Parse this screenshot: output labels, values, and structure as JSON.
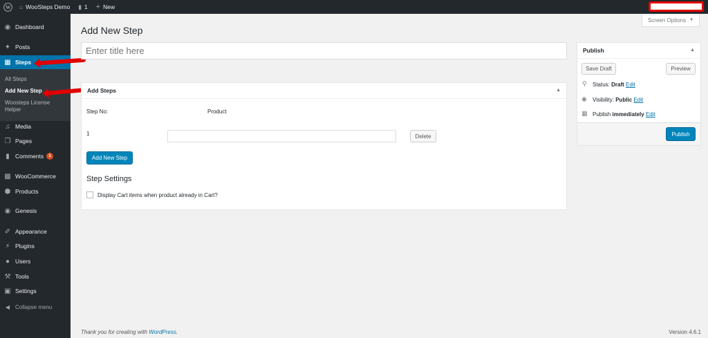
{
  "adminbar": {
    "site_name": "WooSteps Demo",
    "comments_count": "1",
    "new_label": "New"
  },
  "sidebar": {
    "dashboard": "Dashboard",
    "posts": "Posts",
    "steps": "Steps",
    "submenu": {
      "all_steps": "All Steps",
      "add_new_step": "Add New Step",
      "license_line1": "Woosteps License",
      "license_line2": "Helper"
    },
    "media": "Media",
    "pages": "Pages",
    "comments": "Comments",
    "comments_badge": "1",
    "woocommerce": "WooCommerce",
    "products": "Products",
    "genesis": "Genesis",
    "appearance": "Appearance",
    "plugins": "Plugins",
    "users": "Users",
    "tools": "Tools",
    "settings": "Settings",
    "collapse": "Collapse menu"
  },
  "main": {
    "page_title": "Add New Step",
    "screen_options": "Screen Options",
    "title_placeholder": "Enter title here",
    "steps_box": {
      "heading": "Add Steps",
      "col_step_no": "Step No:",
      "col_product": "Product",
      "row_number": "1",
      "delete_label": "Delete",
      "add_new_step_label": "Add New Step",
      "settings_heading": "Step Settings",
      "checkbox_label": "Display Cart items when product already in Cart?"
    }
  },
  "publish": {
    "heading": "Publish",
    "save_draft": "Save Draft",
    "preview": "Preview",
    "status_label": "Status:",
    "status_value": "Draft",
    "visibility_label": "Visibility:",
    "visibility_value": "Public",
    "publish_label": "Publish",
    "publish_value": "immediately",
    "edit_label": "Edit",
    "publish_button": "Publish"
  },
  "footer": {
    "thank_you_prefix": "Thank you for creating with",
    "wordpress_link": "WordPress",
    "version": "Version 4.6.1"
  },
  "colors": {
    "adminbar_bg": "#23282d",
    "active_menu": "#0073aa",
    "primary_button": "#0085ba",
    "annotation_red": "#e00000"
  }
}
